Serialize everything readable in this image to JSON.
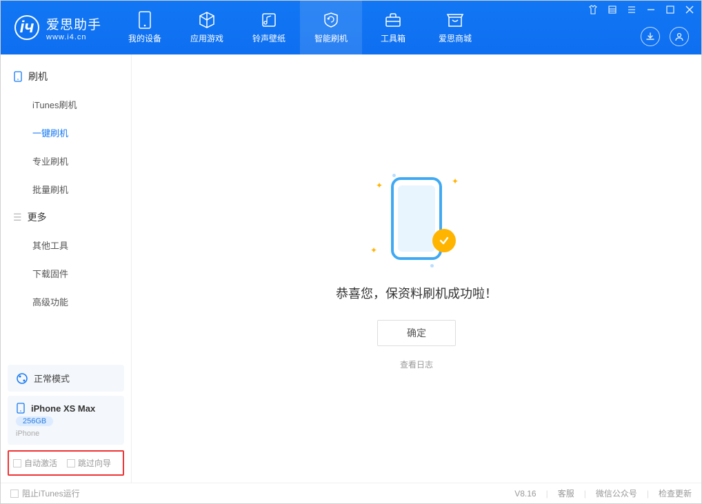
{
  "app": {
    "title": "爱思助手",
    "subtitle": "www.i4.cn"
  },
  "tabs": [
    {
      "label": "我的设备"
    },
    {
      "label": "应用游戏"
    },
    {
      "label": "铃声壁纸"
    },
    {
      "label": "智能刷机"
    },
    {
      "label": "工具箱"
    },
    {
      "label": "爱思商城"
    }
  ],
  "sidebar": {
    "group1_title": "刷机",
    "group1": [
      {
        "label": "iTunes刷机"
      },
      {
        "label": "一键刷机"
      },
      {
        "label": "专业刷机"
      },
      {
        "label": "批量刷机"
      }
    ],
    "group2_title": "更多",
    "group2": [
      {
        "label": "其他工具"
      },
      {
        "label": "下载固件"
      },
      {
        "label": "高级功能"
      }
    ],
    "mode": "正常模式",
    "device": {
      "name": "iPhone XS Max",
      "storage": "256GB",
      "type": "iPhone"
    },
    "auto_activate": "自动激活",
    "skip_guide": "跳过向导"
  },
  "main": {
    "success_text": "恭喜您，保资料刷机成功啦！",
    "ok_button": "确定",
    "view_log": "查看日志"
  },
  "status": {
    "block_itunes": "阻止iTunes运行",
    "version": "V8.16",
    "support": "客服",
    "wechat": "微信公众号",
    "check_update": "检查更新"
  }
}
